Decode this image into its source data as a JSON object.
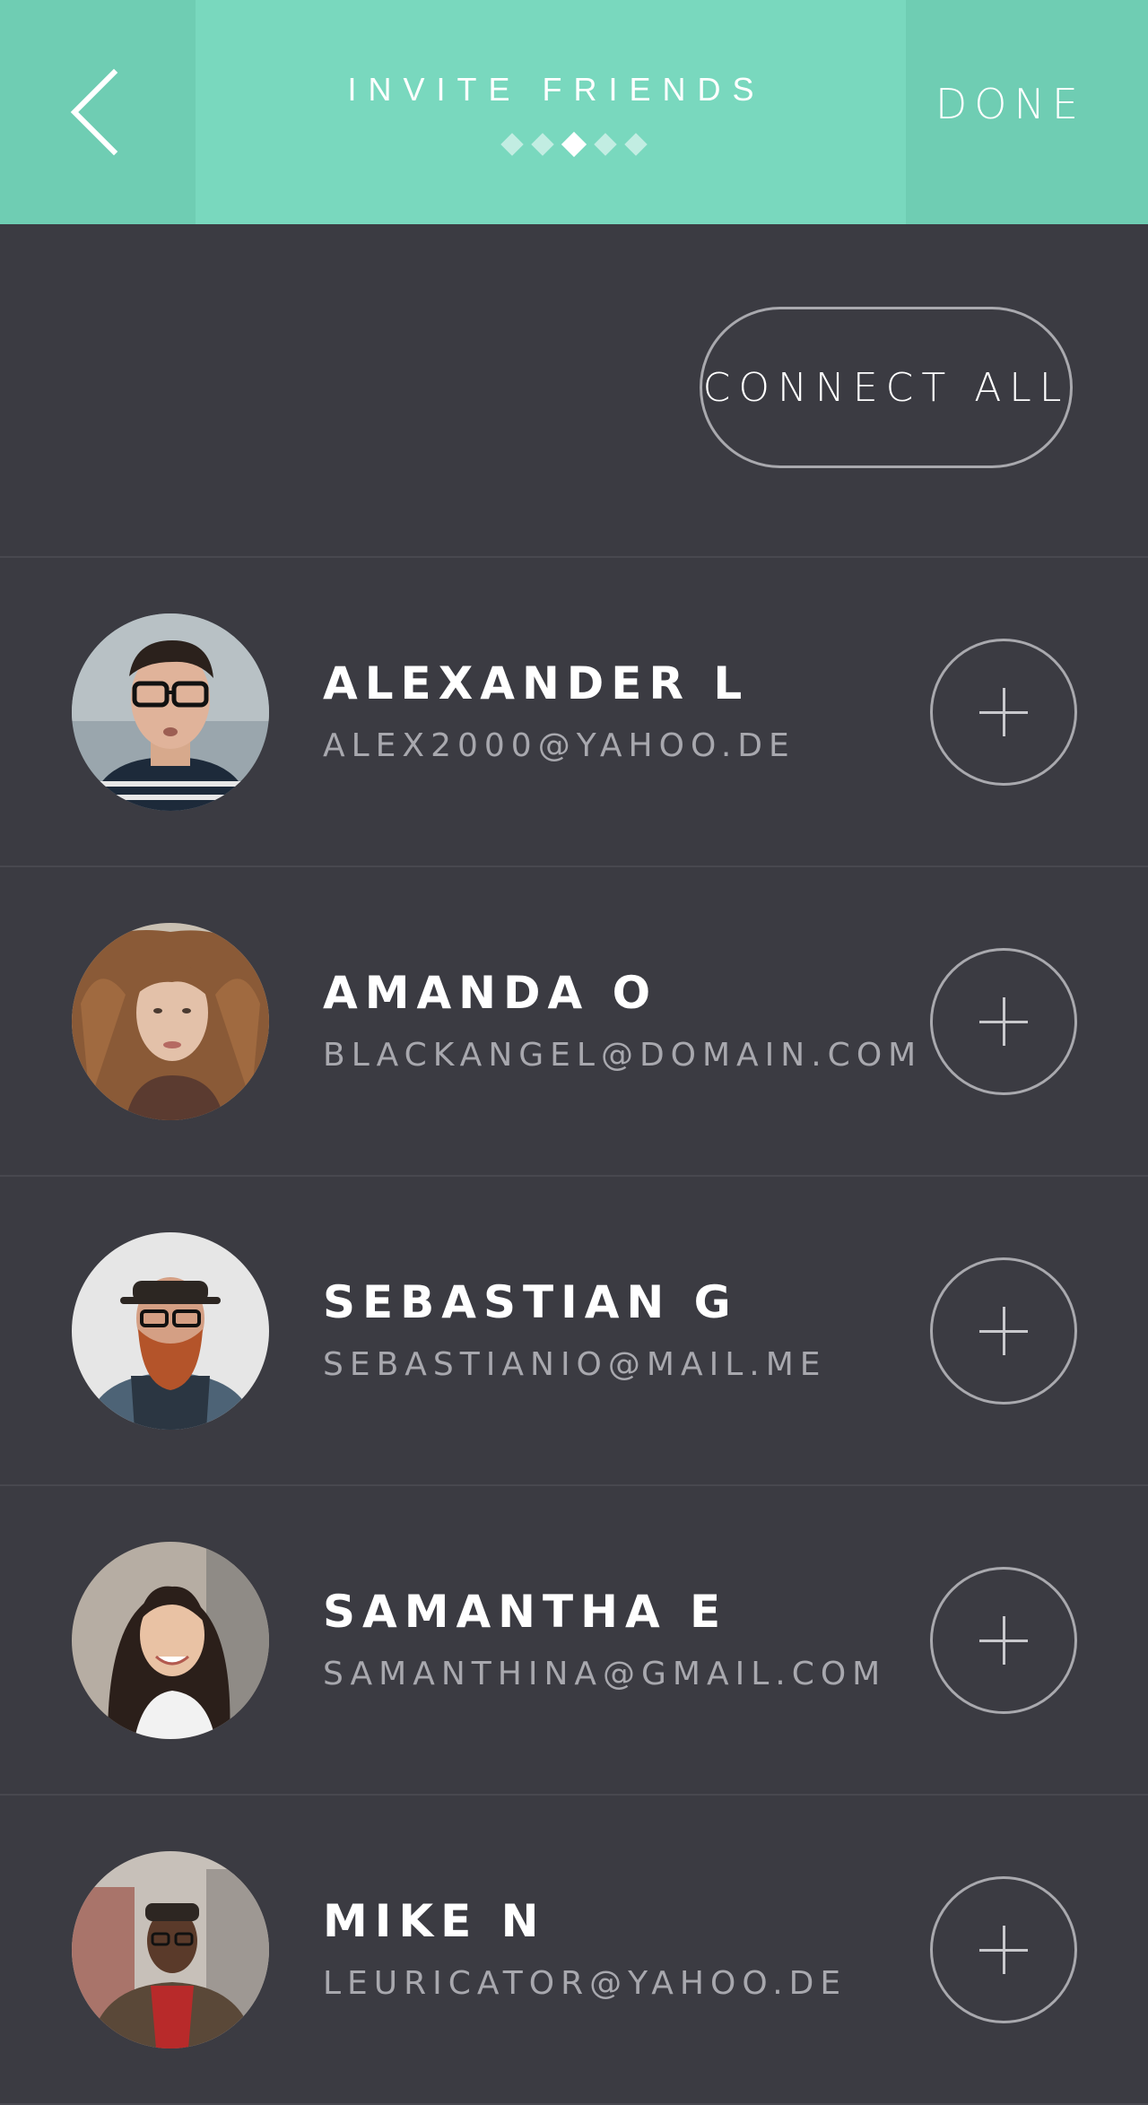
{
  "header": {
    "title": "INVITE FRIENDS",
    "done_label": "DONE",
    "pager": {
      "total": 5,
      "active_index": 2
    },
    "back_icon": "chevron-left-icon"
  },
  "actions": {
    "connect_all_label": "CONNECT ALL"
  },
  "contacts": [
    {
      "name": "ALEXANDER L",
      "email": "ALEX2000@YAHOO.DE",
      "add_icon": "plus-icon"
    },
    {
      "name": "AMANDA O",
      "email": "BLACKANGEL@DOMAIN.COM",
      "add_icon": "plus-icon"
    },
    {
      "name": "SEBASTIAN G",
      "email": "SEBASTIANIO@MAIL.ME",
      "add_icon": "plus-icon"
    },
    {
      "name": "SAMANTHA E",
      "email": "SAMANTHINA@GMAIL.COM",
      "add_icon": "plus-icon"
    },
    {
      "name": "MIKE N",
      "email": "LEURICATOR@YAHOO.DE",
      "add_icon": "plus-icon"
    }
  ],
  "colors": {
    "header_bg": "#79d8be",
    "header_side_bg": "#6fcdb3",
    "page_bg": "#3b3b42",
    "divider": "#48484f",
    "email_text": "#a8a8ae",
    "outline": "#a9a9ae"
  }
}
